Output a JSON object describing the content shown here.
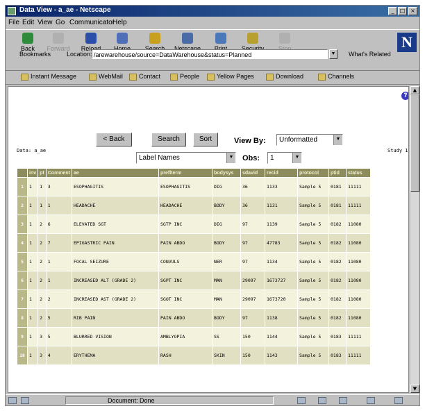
{
  "window": {
    "title": "Data View - a_ae - Netscape",
    "controls": [
      "_",
      "□",
      "×"
    ]
  },
  "menu": [
    "File",
    "Edit",
    "View",
    "Go",
    "Communicator",
    "Help"
  ],
  "toolbar": {
    "buttons": [
      {
        "label": "Back",
        "icon": "back-arrow-icon",
        "enabled": true,
        "color": "#2e8b3a"
      },
      {
        "label": "Forward",
        "icon": "forward-arrow-icon",
        "enabled": false,
        "color": "#b0b0b0"
      },
      {
        "label": "Reload",
        "icon": "reload-icon",
        "enabled": true,
        "color": "#2b4fa8"
      },
      {
        "label": "Home",
        "icon": "home-icon",
        "enabled": true,
        "color": "#4f6fb8"
      },
      {
        "label": "Search",
        "icon": "search-icon",
        "enabled": true,
        "color": "#c8a020"
      },
      {
        "label": "Netscape",
        "icon": "netscape-icon",
        "enabled": true,
        "color": "#4a6aa8"
      },
      {
        "label": "Print",
        "icon": "print-icon",
        "enabled": true,
        "color": "#4a78b8"
      },
      {
        "label": "Security",
        "icon": "lock-icon",
        "enabled": true,
        "color": "#b8a030"
      },
      {
        "label": "Stop",
        "icon": "stop-icon",
        "enabled": false,
        "color": "#b0b0b0"
      }
    ]
  },
  "location": {
    "bookmarks_label": "Bookmarks",
    "label": "Location:",
    "value": "/arewarehouse/source=DataWarehouse&status=Planned",
    "related_label": "What's Related"
  },
  "personal_toolbar": [
    "Instant Message",
    "WebMail",
    "Contact",
    "People",
    "Yellow Pages",
    "Download",
    "Channels"
  ],
  "page": {
    "buttons": {
      "back": "< Back",
      "search": "Search",
      "sort": "Sort"
    },
    "view_by_label": "View By:",
    "view_by_value": "Unformatted",
    "label_select_value": "Label Names",
    "obs_label": "Obs:",
    "obs_value": "1",
    "data_label": "Data: a_ae",
    "study_label": "Study 1"
  },
  "table": {
    "columns": [
      "",
      "inv",
      "pt",
      "Comment",
      "ae",
      "preflterm",
      "bodysys",
      "sdavid",
      "recid",
      "protocol",
      "ptid",
      "status"
    ],
    "rows": [
      [
        "1",
        "1",
        "1",
        "3",
        "ESOPHAGITIS",
        "ESOPHAGITIS",
        "DIG",
        "36",
        "1133",
        "Sample 5",
        "0181",
        "11111"
      ],
      [
        "2",
        "1",
        "1",
        "1",
        "HEADACHE",
        "HEADACHE",
        "BODY",
        "36",
        "1131",
        "Sample 5",
        "0181",
        "11111"
      ],
      [
        "3",
        "1",
        "2",
        "6",
        "ELEVATED SGT",
        "SGTP INC",
        "DIG",
        "97",
        "1139",
        "Sample 5",
        "0182",
        "11080"
      ],
      [
        "4",
        "1",
        "2",
        "7",
        "EPIGASTRIC PAIN",
        "PAIN ABDO",
        "BODY",
        "97",
        "47783",
        "Sample 5",
        "0182",
        "11080"
      ],
      [
        "5",
        "1",
        "2",
        "1",
        "FOCAL SEIZURE",
        "CONVULS",
        "NER",
        "97",
        "1134",
        "Sample 5",
        "0182",
        "11080"
      ],
      [
        "6",
        "1",
        "2",
        "1",
        "INCREASED ALT (GRADE 2)",
        "SGPT INC",
        "MAN",
        "29097",
        "1673727",
        "Sample 5",
        "0182",
        "11080"
      ],
      [
        "7",
        "1",
        "2",
        "2",
        "INCREASED AST (GRADE 2)",
        "SGOT INC",
        "MAN",
        "29097",
        "1673720",
        "Sample 5",
        "0182",
        "11080"
      ],
      [
        "8",
        "1",
        "2",
        "5",
        "RIB PAIN",
        "PAIN ABDO",
        "BODY",
        "97",
        "1138",
        "Sample 5",
        "0182",
        "11080"
      ],
      [
        "9",
        "1",
        "3",
        "5",
        "BLURRED VISION",
        "AMBLYOPIA",
        "SS",
        "150",
        "1144",
        "Sample 5",
        "0183",
        "11111"
      ],
      [
        "10",
        "1",
        "3",
        "4",
        "ERYTHEMA",
        "RASH",
        "SKIN",
        "150",
        "1143",
        "Sample 5",
        "0183",
        "11111"
      ]
    ]
  },
  "status": {
    "text": "Document: Done"
  }
}
